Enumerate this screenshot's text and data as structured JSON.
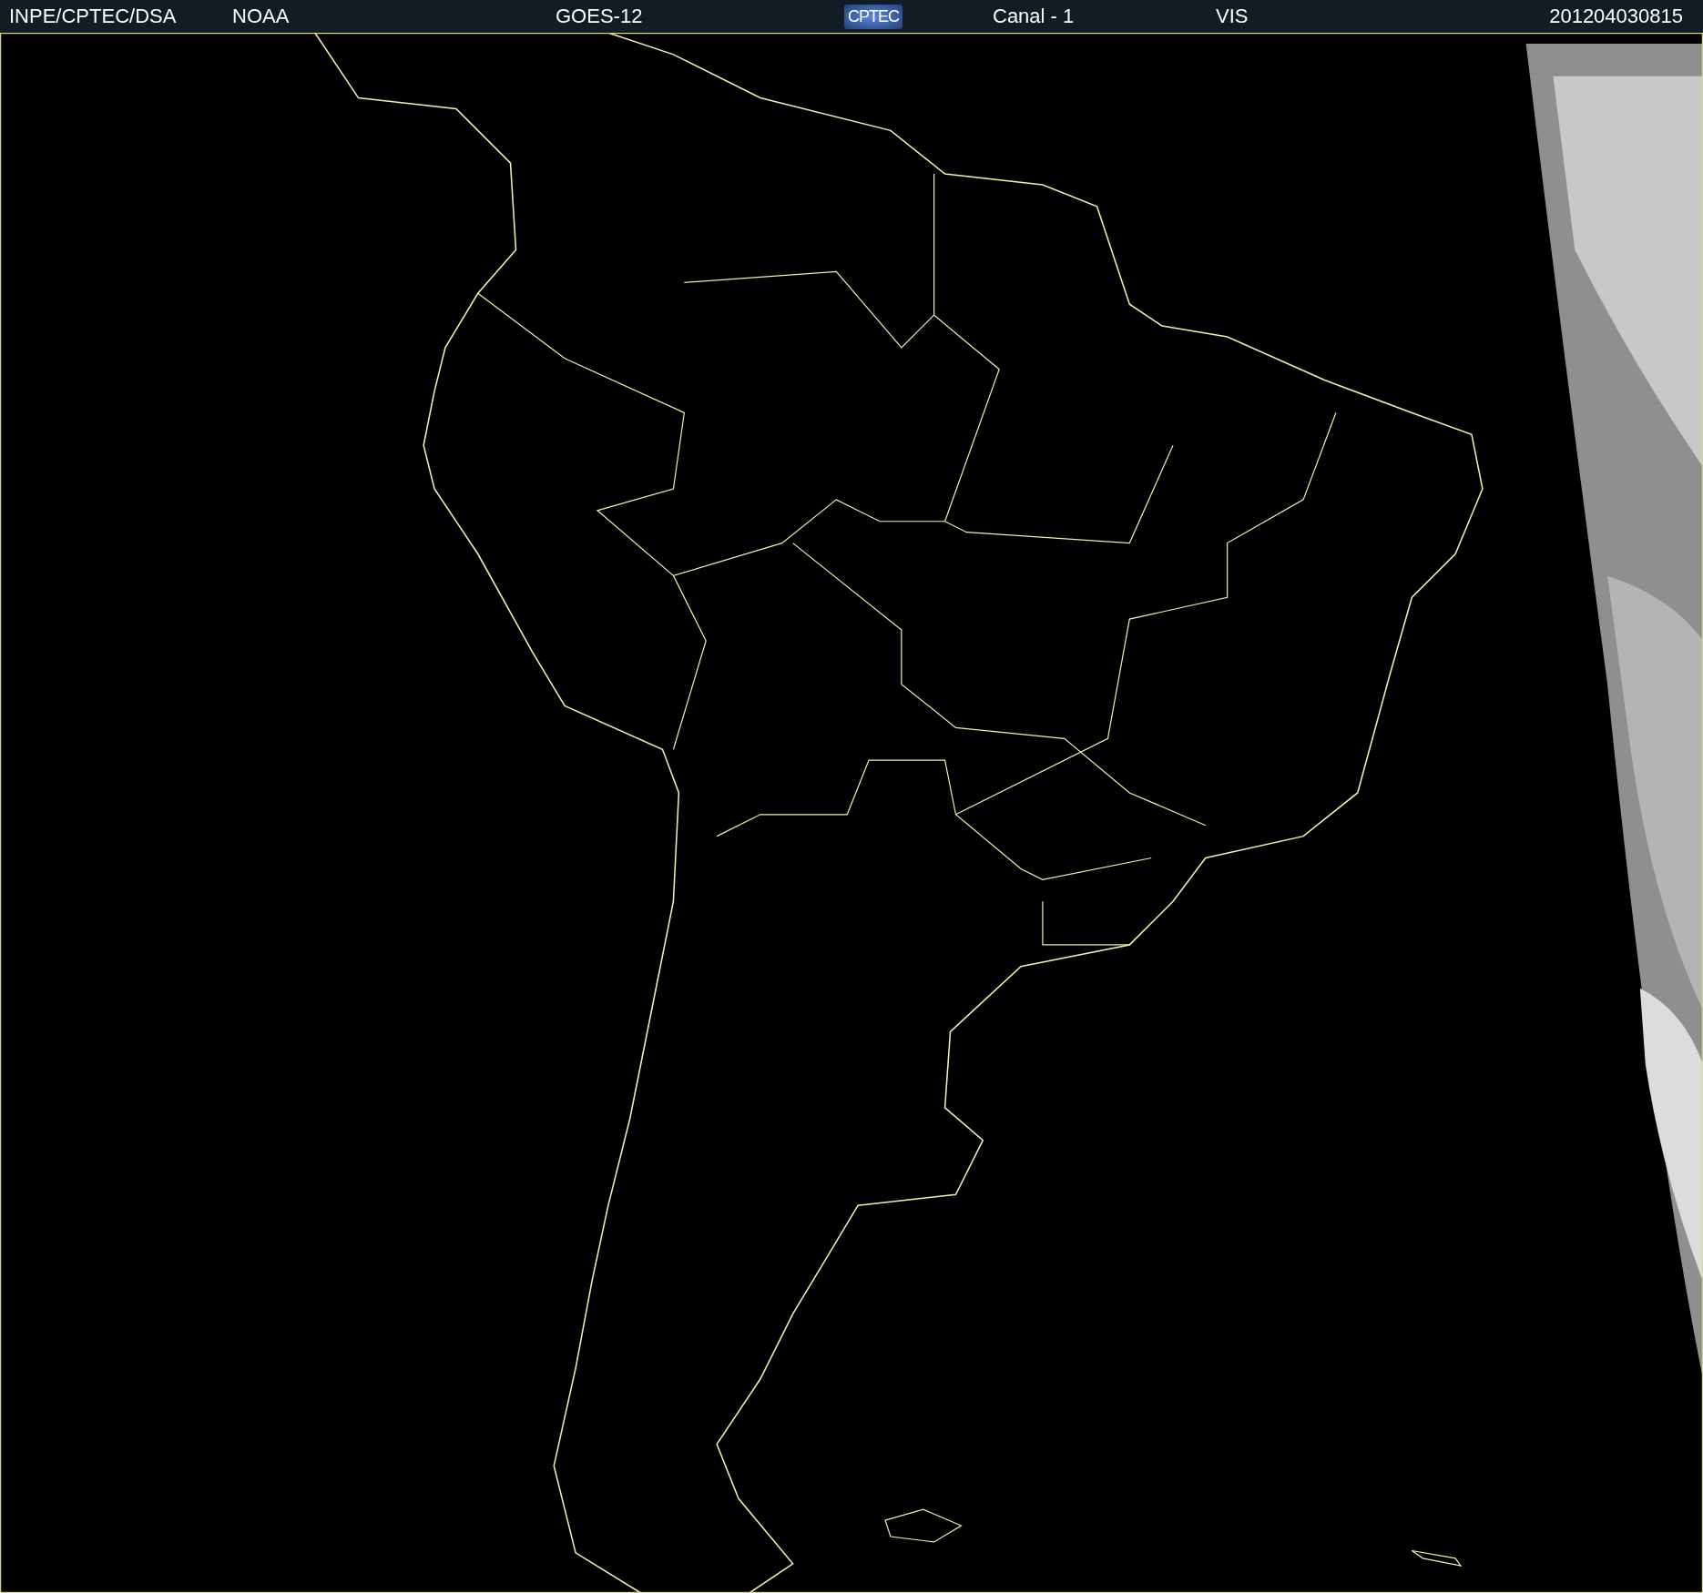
{
  "header": {
    "source": "INPE/CPTEC/DSA",
    "agency": "NOAA",
    "satellite": "GOES-12",
    "logo": "CPTEC",
    "channel": "Canal - 1",
    "band": "VIS",
    "timestamp": "201204030815"
  }
}
